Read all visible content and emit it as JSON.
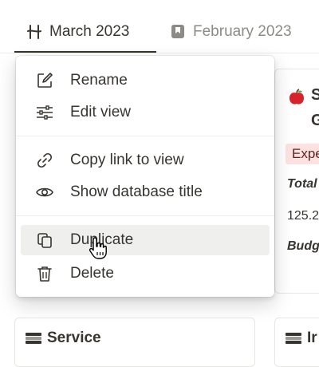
{
  "tabs": {
    "active": {
      "label": "March 2023",
      "icon": "view-icon"
    },
    "inactive": {
      "label": "February 2023",
      "icon": "bookmark-icon"
    }
  },
  "menu": {
    "items": [
      {
        "label": "Rename",
        "icon": "edit-icon"
      },
      {
        "label": "Edit view",
        "icon": "sliders-icon"
      },
      {
        "label": "Copy link to view",
        "icon": "link-icon"
      },
      {
        "label": "Show database title",
        "icon": "eye-icon"
      },
      {
        "label": "Duplicate",
        "icon": "duplicate-icon",
        "hovered": true
      },
      {
        "label": "Delete",
        "icon": "trash-icon"
      }
    ]
  },
  "background_card": {
    "title_line1": "S",
    "title_line2": "G",
    "badge": "Expe",
    "total_label": "Total",
    "amount": "125.2",
    "budget_label": "Budg"
  },
  "bottom_cards": {
    "left_label": "Service",
    "right_label": "Ir"
  },
  "colors": {
    "text": "#37352f",
    "muted": "#8c8b86",
    "hover_bg": "#efefee",
    "badge_bg": "#fde2e1",
    "badge_text": "#5d2623"
  }
}
